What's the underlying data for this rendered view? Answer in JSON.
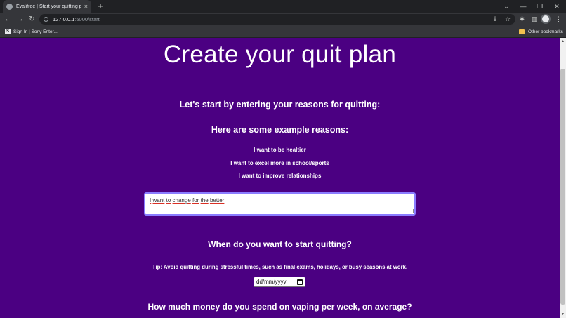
{
  "browser": {
    "tab_title": "Evalifree | Start your quitting pla",
    "url_host": "127.0.0.1",
    "url_path": ":5000/start",
    "bookmark_1": "Sign In | Sony Enter...",
    "bookmark_1_favicon": "S",
    "other_bookmarks": "Other bookmarks",
    "icons": {
      "close": "×",
      "new_tab": "+",
      "minimize": "—",
      "restore": "❐",
      "window_close": "✕",
      "dropdown": "⌄",
      "back": "←",
      "forward": "→",
      "reload": "↻",
      "share": "⇪",
      "star": "☆",
      "extensions": "✱",
      "sidebar": "▥",
      "menu": "⋮"
    }
  },
  "page": {
    "title": "Create your quit plan",
    "reasons_heading": "Let's start by entering your reasons for quitting:",
    "examples_heading": "Here are some example reasons:",
    "examples": [
      "I want to be healtier",
      "I want to excel more in school/sports",
      "I want to improve relationships"
    ],
    "reason_input_value": "I want to change for the better",
    "start_heading": "When do you want to start quitting?",
    "tip": "Tip: Avoid quitting during stressful times, such as final exams, holidays, or busy seasons at work.",
    "date_placeholder": "dd/mm/yyyy",
    "money_heading": "How much money do you spend on vaping per week, on average?"
  },
  "colors": {
    "page_background": "#4b0082",
    "text": "#ffffff",
    "input_focus_border": "#8a7cff"
  }
}
